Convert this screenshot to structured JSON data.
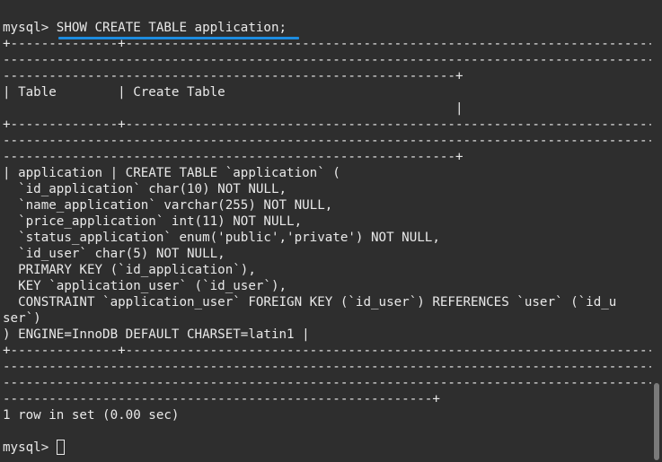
{
  "terminal": {
    "prompt": "mysql> ",
    "command": "SHOW CREATE TABLE application;",
    "lines": [
      "+--------------+--------------------------------------------------------------------------------------------------------",
      "----------------------------------------------------------------------------------------------------------------------------",
      "-----------------------------------------------------------+",
      "| Table        | Create Table",
      "                                                           |",
      "+--------------+--------------------------------------------------------------------------------------------------------",
      "----------------------------------------------------------------------------------------------------------------------------",
      "-----------------------------------------------------------+",
      "| application | CREATE TABLE `application` (",
      "  `id_application` char(10) NOT NULL,",
      "  `name_application` varchar(255) NOT NULL,",
      "  `price_application` int(11) NOT NULL,",
      "  `status_application` enum('public','private') NOT NULL,",
      "  `id_user` char(5) NOT NULL,",
      "  PRIMARY KEY (`id_application`),",
      "  KEY `application_user` (`id_user`),",
      "  CONSTRAINT `application_user` FOREIGN KEY (`id_user`) REFERENCES `user` (`id_u",
      "ser`)",
      ") ENGINE=InnoDB DEFAULT CHARSET=latin1 |",
      "+--------------+--------------------------------------------------------------------------------------------------------",
      "----------------------------------------------------------------------------------------------------------------------------",
      "----------------------------------------------------------------------------------------------------------------------------",
      "--------------------------------------------------------+",
      "1 row in set (0.00 sec)",
      ""
    ],
    "final_prompt": "mysql> "
  },
  "colors": {
    "background": "#2e2e2e",
    "text": "#e9e9e9",
    "underline": "#1d8ce0",
    "scrollbar_thumb": "#7a7a7a"
  }
}
